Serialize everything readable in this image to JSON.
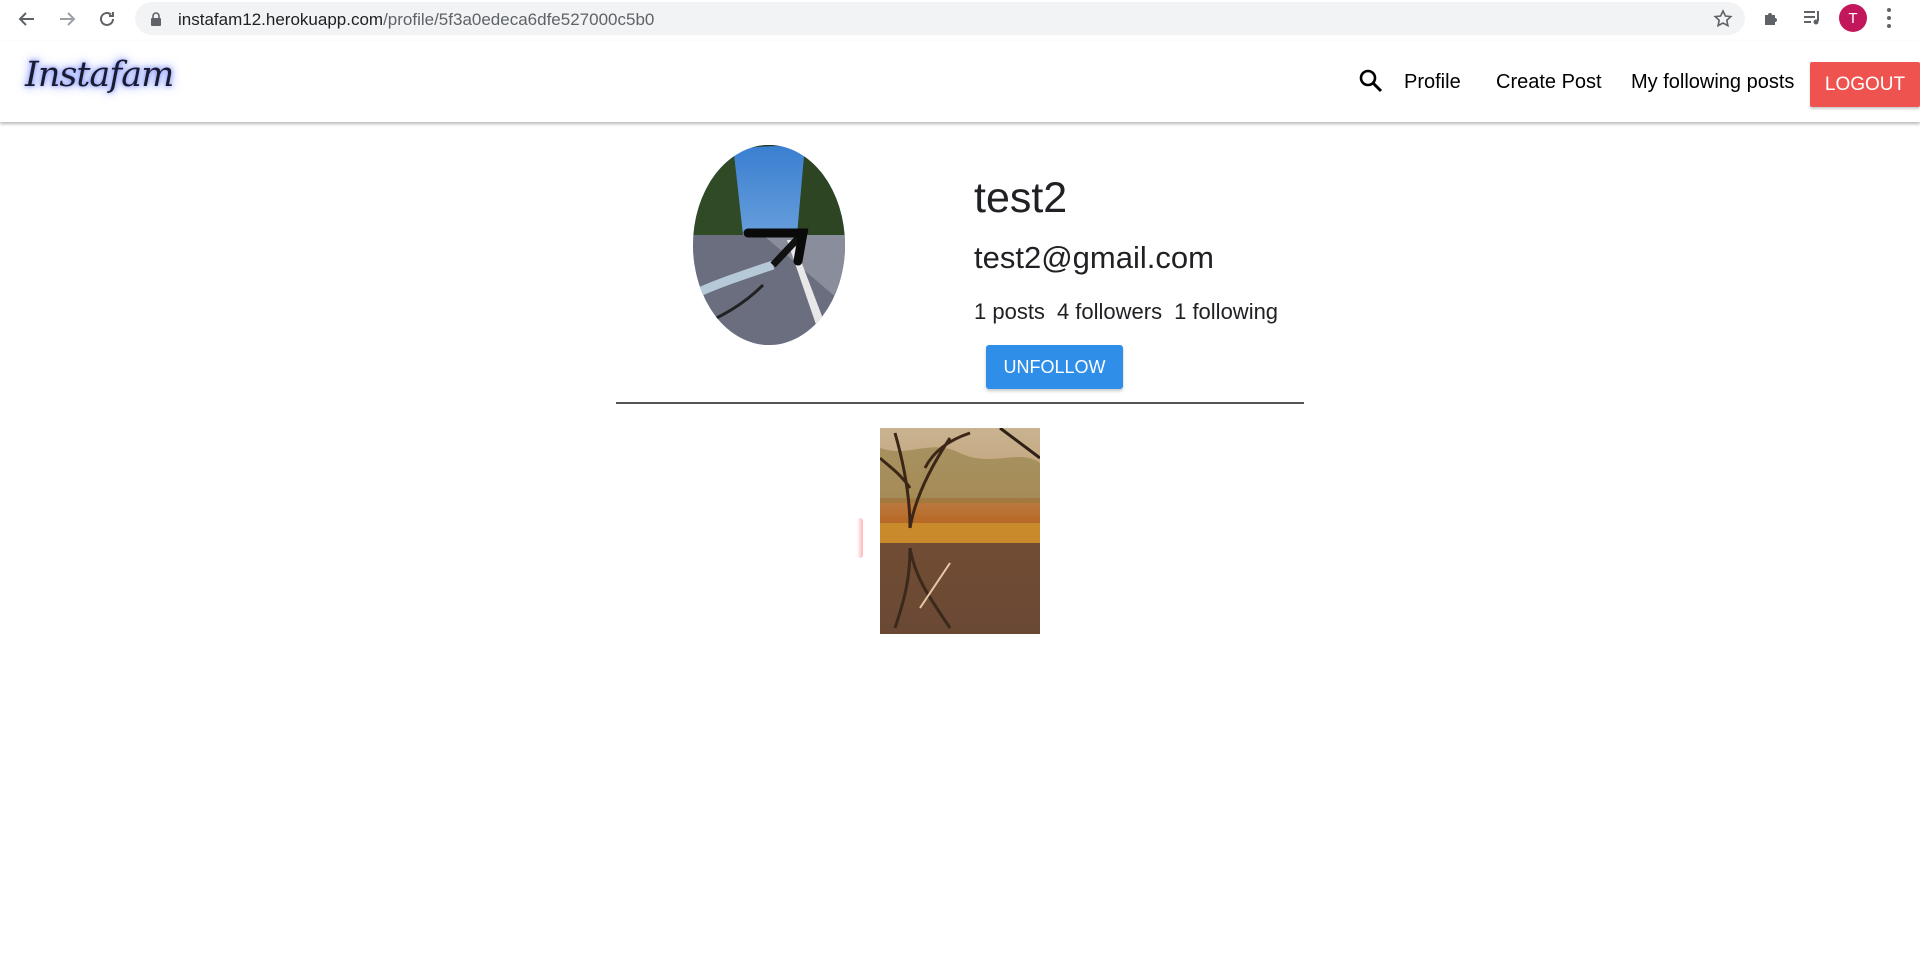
{
  "browser": {
    "url_host": "instafam12.herokuapp.com",
    "url_path": "/profile/5f3a0edeca6dfe527000c5b0",
    "profile_initial": "T"
  },
  "navbar": {
    "logo": "Instafam",
    "links": [
      "Profile",
      "Create Post",
      "My following posts"
    ],
    "logout_label": "LOGOUT"
  },
  "profile": {
    "name": "test2",
    "email": "test2@gmail.com",
    "stats": {
      "posts": "1 posts",
      "followers": "4 followers",
      "following": "1 following"
    },
    "unfollow_label": "UNFOLLOW"
  },
  "colors": {
    "logout": "#ef5350",
    "unfollow": "#2f8ee8",
    "profile_chip": "#c2185b"
  }
}
